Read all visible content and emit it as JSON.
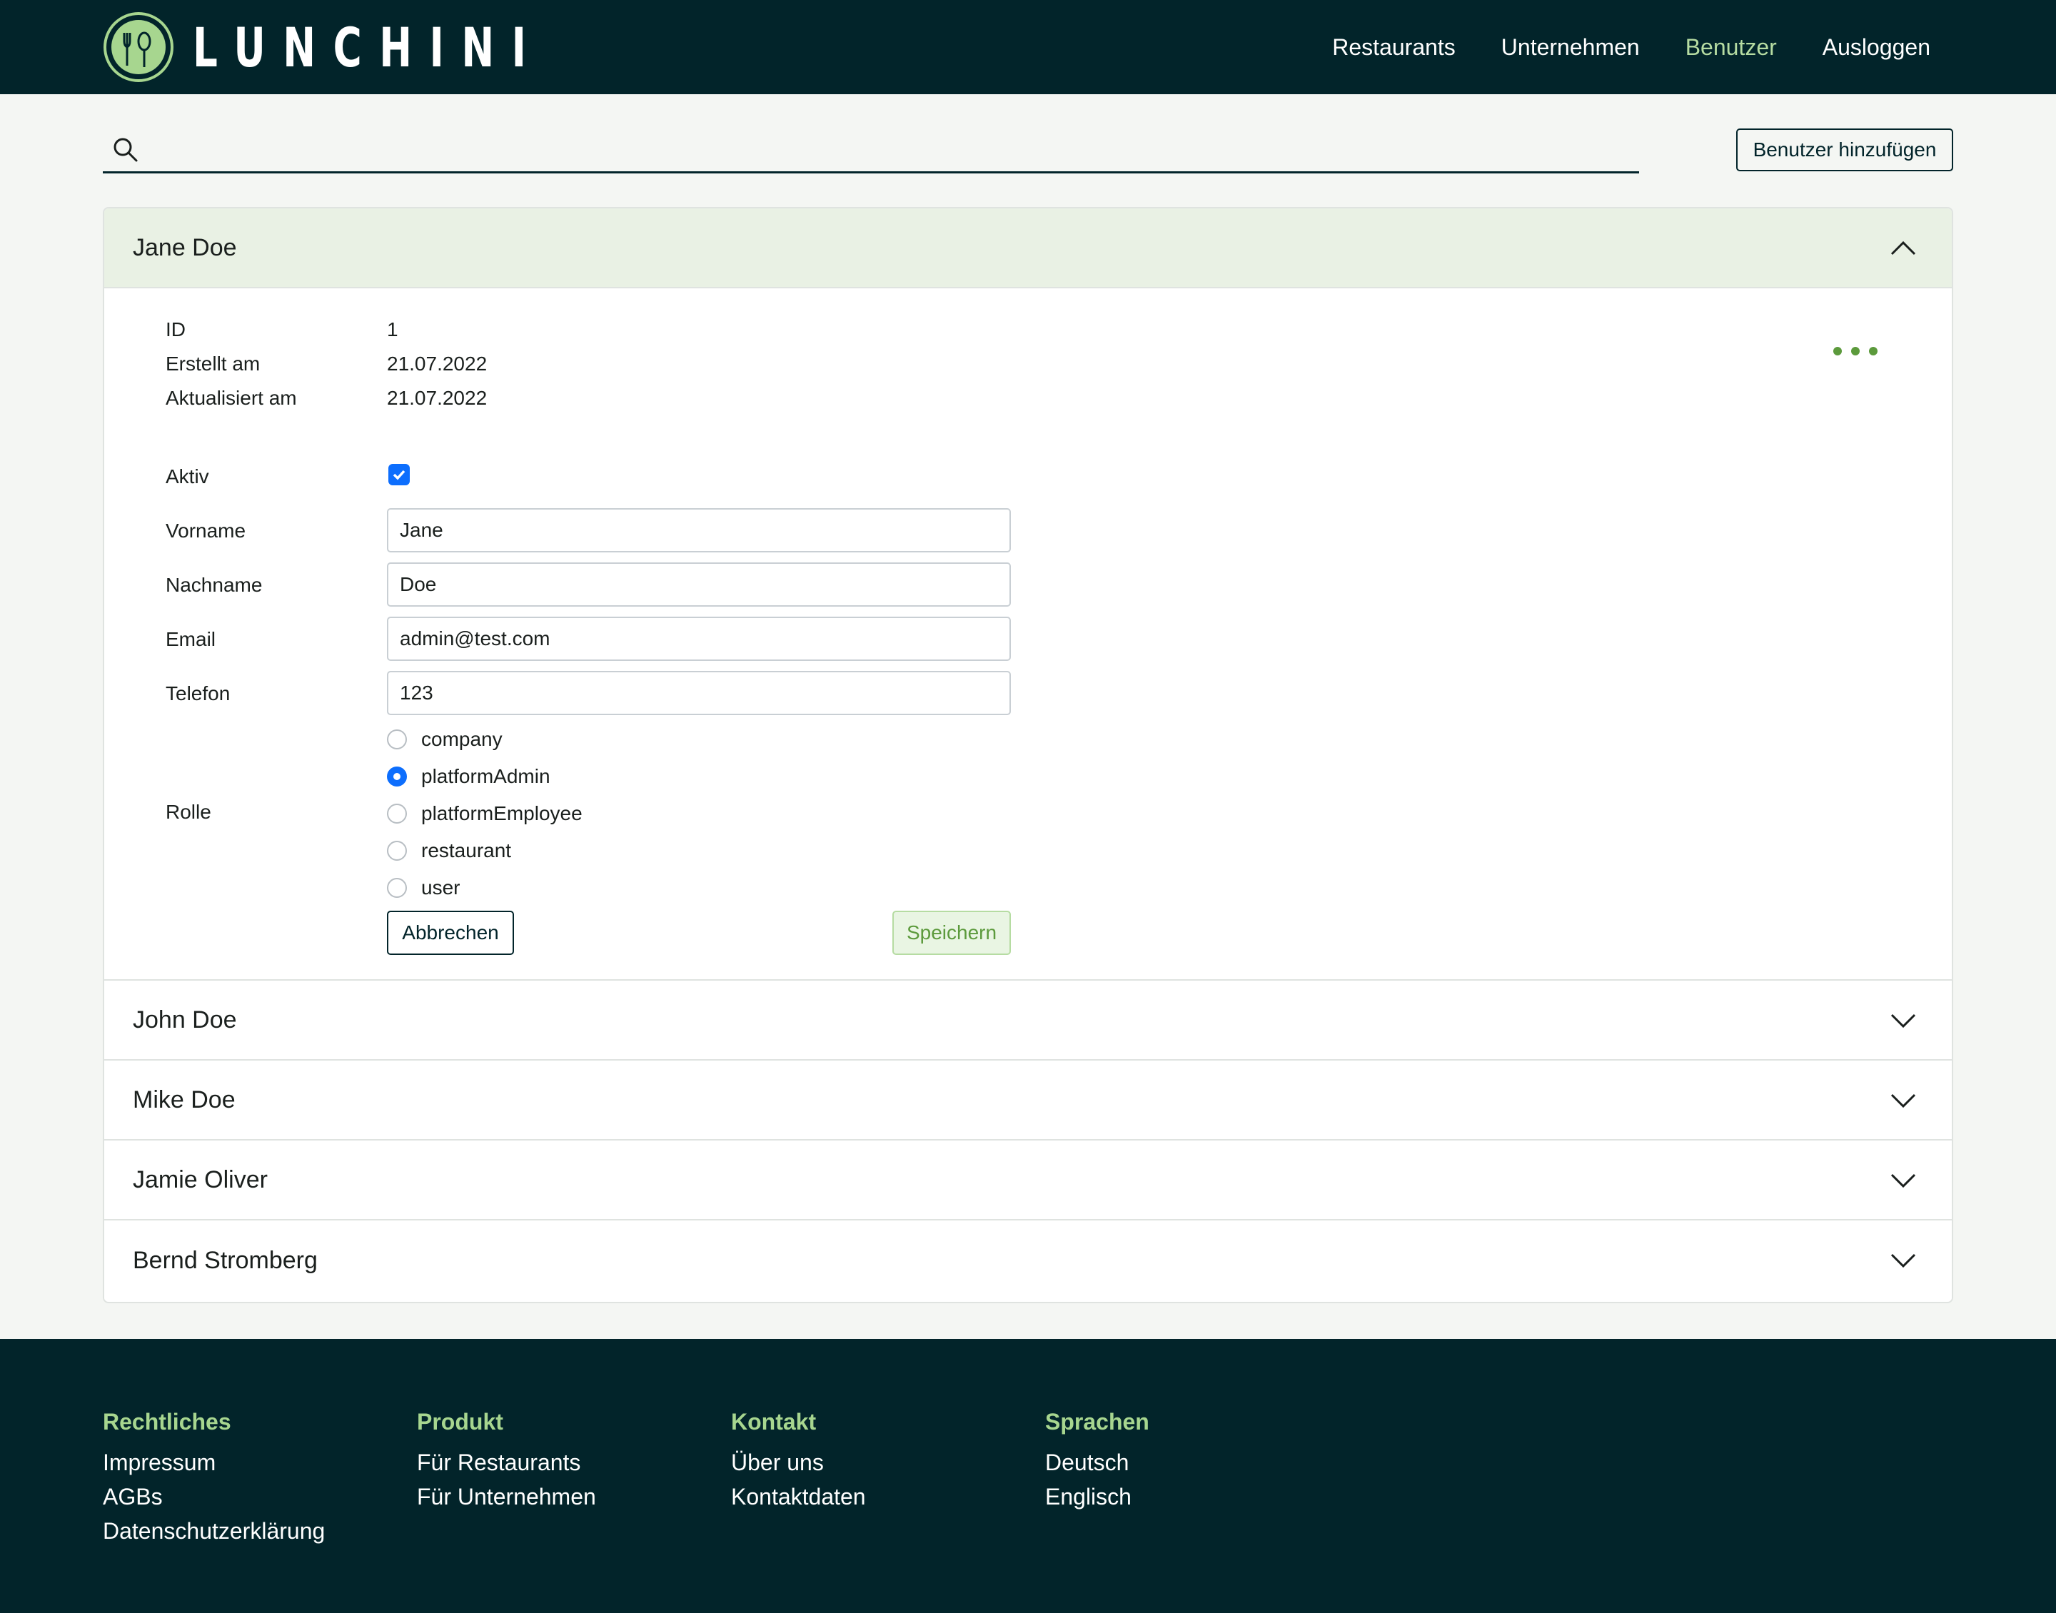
{
  "brand": {
    "name": "LUNCHINI",
    "logo_color": "#a7d68f"
  },
  "nav": {
    "items": [
      {
        "label": "Restaurants",
        "active": false
      },
      {
        "label": "Unternehmen",
        "active": false
      },
      {
        "label": "Benutzer",
        "active": true
      },
      {
        "label": "Ausloggen",
        "active": false
      }
    ]
  },
  "search": {
    "value": "",
    "placeholder": "",
    "icon": "search-icon"
  },
  "toolbar": {
    "add_user_label": "Benutzer hinzufügen"
  },
  "users": [
    {
      "name": "Jane Doe",
      "expanded": true
    },
    {
      "name": "John Doe",
      "expanded": false
    },
    {
      "name": "Mike Doe",
      "expanded": false
    },
    {
      "name": "Jamie Oliver",
      "expanded": false
    },
    {
      "name": "Bernd Stromberg",
      "expanded": false
    }
  ],
  "detail": {
    "meta": [
      {
        "label": "ID",
        "value": "1"
      },
      {
        "label": "Erstellt am",
        "value": "21.07.2022"
      },
      {
        "label": "Aktualisiert am",
        "value": "21.07.2022"
      }
    ],
    "active_label": "Aktiv",
    "active_checked": true,
    "fields": [
      {
        "label": "Vorname",
        "value": "Jane"
      },
      {
        "label": "Nachname",
        "value": "Doe"
      },
      {
        "label": "Email",
        "value": "admin@test.com"
      },
      {
        "label": "Telefon",
        "value": "123"
      }
    ],
    "role_label": "Rolle",
    "roles": [
      "company",
      "platformAdmin",
      "platformEmployee",
      "restaurant",
      "user"
    ],
    "selected_role": "platformAdmin",
    "cancel_label": "Abbrechen",
    "save_label": "Speichern",
    "more_icon": "more-dots-icon"
  },
  "footer": {
    "columns": [
      {
        "title": "Rechtliches",
        "links": [
          "Impressum",
          "AGBs",
          "Datenschutzerklärung"
        ]
      },
      {
        "title": "Produkt",
        "links": [
          "Für Restaurants",
          "Für Unternehmen"
        ]
      },
      {
        "title": "Kontakt",
        "links": [
          "Über uns",
          "Kontaktdaten"
        ]
      },
      {
        "title": "Sprachen",
        "links": [
          "Deutsch",
          "Englisch"
        ]
      }
    ]
  },
  "colors": {
    "navbar_bg": "#02242a",
    "accent_green": "#a7d68f",
    "primary_blue": "#0d6efd",
    "open_header_bg": "#e9f1e4",
    "save_text": "#5c9a3c"
  }
}
